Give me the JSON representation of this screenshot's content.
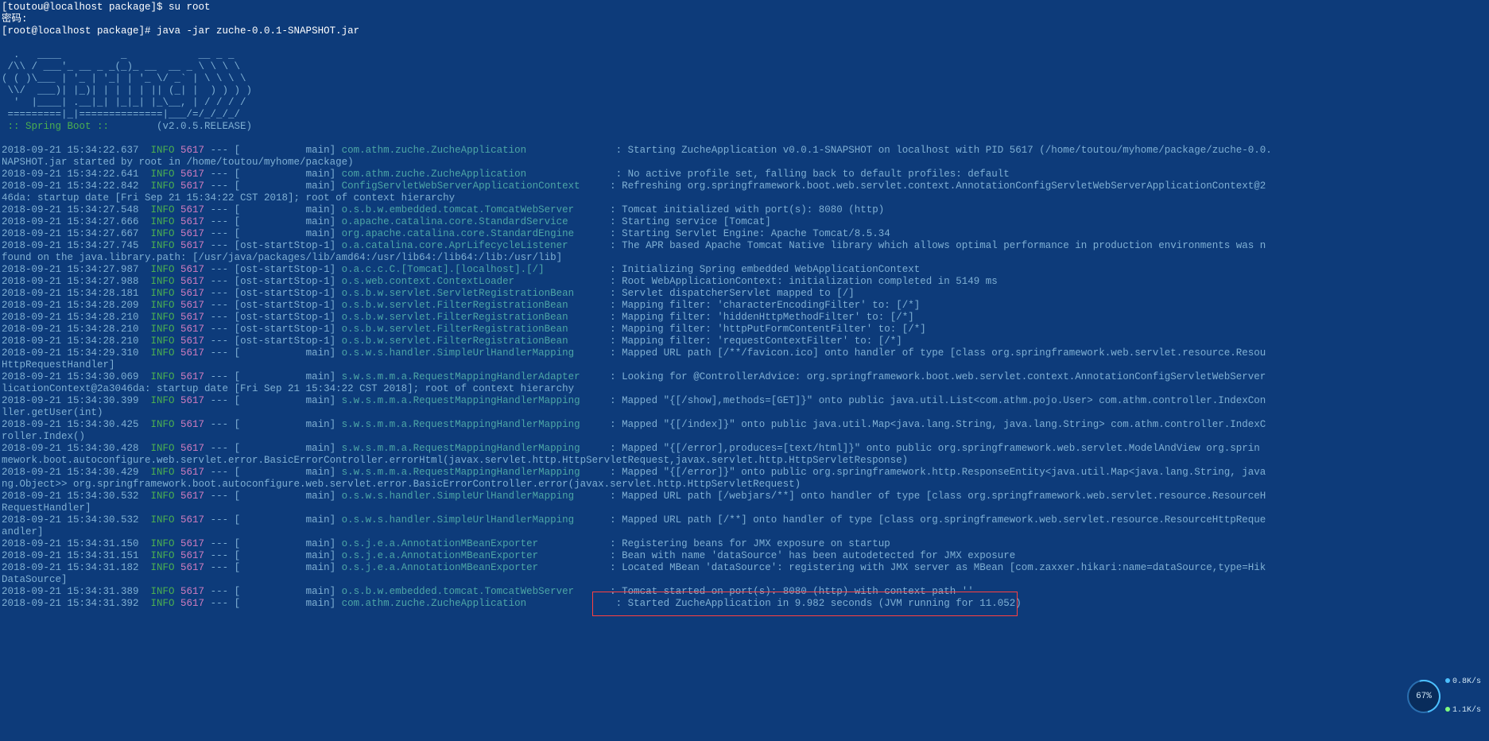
{
  "widget": {
    "percent": "67%",
    "up": "0.8K/s",
    "dn": "1.1K/s"
  },
  "springBanner": {
    "boot_label": " :: Spring Boot ::",
    "version": "(v2.0.5.RELEASE)"
  },
  "cmd": {
    "l1": "[toutou@localhost package]$ su root",
    "l2": "密码:",
    "l3": "[root@localhost package]# java -jar zuche-0.0.1-SNAPSHOT.jar"
  },
  "colsep": " --- [",
  "rows": [
    {
      "ts": "2018-09-21 15:34:22.637",
      "lvl": "INFO ",
      "pid": "5617",
      "thr": "           main] ",
      "cls": "com.athm.zuche.ZucheApplication               ",
      "msg": ": Starting ZucheApplication v0.0.1-SNAPSHOT on localhost with PID 5617 (/home/toutou/myhome/package/zuche-0.0."
    },
    {
      "ts": "",
      "wrap": "NAPSHOT.jar started by root in /home/toutou/myhome/package)"
    },
    {
      "ts": "2018-09-21 15:34:22.641",
      "lvl": "INFO ",
      "pid": "5617",
      "thr": "           main] ",
      "cls": "com.athm.zuche.ZucheApplication               ",
      "msg": ": No active profile set, falling back to default profiles: default"
    },
    {
      "ts": "2018-09-21 15:34:22.842",
      "lvl": "INFO ",
      "pid": "5617",
      "thr": "           main] ",
      "cls": "ConfigServletWebServerApplicationContext     ",
      "msg": ": Refreshing org.springframework.boot.web.servlet.context.AnnotationConfigServletWebServerApplicationContext@2"
    },
    {
      "ts": "",
      "wrap": "46da: startup date [Fri Sep 21 15:34:22 CST 2018]; root of context hierarchy"
    },
    {
      "ts": "2018-09-21 15:34:27.548",
      "lvl": "INFO ",
      "pid": "5617",
      "thr": "           main] ",
      "cls": "o.s.b.w.embedded.tomcat.TomcatWebServer      ",
      "msg": ": Tomcat initialized with port(s): 8080 (http)"
    },
    {
      "ts": "2018-09-21 15:34:27.666",
      "lvl": "INFO ",
      "pid": "5617",
      "thr": "           main] ",
      "cls": "o.apache.catalina.core.StandardService       ",
      "msg": ": Starting service [Tomcat]"
    },
    {
      "ts": "2018-09-21 15:34:27.667",
      "lvl": "INFO ",
      "pid": "5617",
      "thr": "           main] ",
      "cls": "org.apache.catalina.core.StandardEngine      ",
      "msg": ": Starting Servlet Engine: Apache Tomcat/8.5.34"
    },
    {
      "ts": "2018-09-21 15:34:27.745",
      "lvl": "INFO ",
      "pid": "5617",
      "thr": "ost-startStop-1] ",
      "cls": "o.a.catalina.core.AprLifecycleListener       ",
      "msg": ": The APR based Apache Tomcat Native library which allows optimal performance in production environments was n"
    },
    {
      "ts": "",
      "wrap": "found on the java.library.path: [/usr/java/packages/lib/amd64:/usr/lib64:/lib64:/lib:/usr/lib]"
    },
    {
      "ts": "2018-09-21 15:34:27.987",
      "lvl": "INFO ",
      "pid": "5617",
      "thr": "ost-startStop-1] ",
      "cls": "o.a.c.c.C.[Tomcat].[localhost].[/]           ",
      "msg": ": Initializing Spring embedded WebApplicationContext"
    },
    {
      "ts": "2018-09-21 15:34:27.988",
      "lvl": "INFO ",
      "pid": "5617",
      "thr": "ost-startStop-1] ",
      "cls": "o.s.web.context.ContextLoader                ",
      "msg": ": Root WebApplicationContext: initialization completed in 5149 ms"
    },
    {
      "ts": "2018-09-21 15:34:28.181",
      "lvl": "INFO ",
      "pid": "5617",
      "thr": "ost-startStop-1] ",
      "cls": "o.s.b.w.servlet.ServletRegistrationBean      ",
      "msg": ": Servlet dispatcherServlet mapped to [/]"
    },
    {
      "ts": "2018-09-21 15:34:28.209",
      "lvl": "INFO ",
      "pid": "5617",
      "thr": "ost-startStop-1] ",
      "cls": "o.s.b.w.servlet.FilterRegistrationBean       ",
      "msg": ": Mapping filter: 'characterEncodingFilter' to: [/*]"
    },
    {
      "ts": "2018-09-21 15:34:28.210",
      "lvl": "INFO ",
      "pid": "5617",
      "thr": "ost-startStop-1] ",
      "cls": "o.s.b.w.servlet.FilterRegistrationBean       ",
      "msg": ": Mapping filter: 'hiddenHttpMethodFilter' to: [/*]"
    },
    {
      "ts": "2018-09-21 15:34:28.210",
      "lvl": "INFO ",
      "pid": "5617",
      "thr": "ost-startStop-1] ",
      "cls": "o.s.b.w.servlet.FilterRegistrationBean       ",
      "msg": ": Mapping filter: 'httpPutFormContentFilter' to: [/*]"
    },
    {
      "ts": "2018-09-21 15:34:28.210",
      "lvl": "INFO ",
      "pid": "5617",
      "thr": "ost-startStop-1] ",
      "cls": "o.s.b.w.servlet.FilterRegistrationBean       ",
      "msg": ": Mapping filter: 'requestContextFilter' to: [/*]"
    },
    {
      "ts": "2018-09-21 15:34:29.310",
      "lvl": "INFO ",
      "pid": "5617",
      "thr": "           main] ",
      "cls": "o.s.w.s.handler.SimpleUrlHandlerMapping      ",
      "msg": ": Mapped URL path [/**/favicon.ico] onto handler of type [class org.springframework.web.servlet.resource.Resou"
    },
    {
      "ts": "",
      "wrap": "HttpRequestHandler]"
    },
    {
      "ts": "2018-09-21 15:34:30.069",
      "lvl": "INFO ",
      "pid": "5617",
      "thr": "           main] ",
      "cls": "s.w.s.m.m.a.RequestMappingHandlerAdapter     ",
      "msg": ": Looking for @ControllerAdvice: org.springframework.boot.web.servlet.context.AnnotationConfigServletWebServer"
    },
    {
      "ts": "",
      "wrap": "licationContext@2a3046da: startup date [Fri Sep 21 15:34:22 CST 2018]; root of context hierarchy"
    },
    {
      "ts": "2018-09-21 15:34:30.399",
      "lvl": "INFO ",
      "pid": "5617",
      "thr": "           main] ",
      "cls": "s.w.s.m.m.a.RequestMappingHandlerMapping     ",
      "msg": ": Mapped \"{[/show],methods=[GET]}\" onto public java.util.List<com.athm.pojo.User> com.athm.controller.IndexCon"
    },
    {
      "ts": "",
      "wrap": "ller.getUser(int)"
    },
    {
      "ts": "2018-09-21 15:34:30.425",
      "lvl": "INFO ",
      "pid": "5617",
      "thr": "           main] ",
      "cls": "s.w.s.m.m.a.RequestMappingHandlerMapping     ",
      "msg": ": Mapped \"{[/index]}\" onto public java.util.Map<java.lang.String, java.lang.String> com.athm.controller.IndexC"
    },
    {
      "ts": "",
      "wrap": "roller.Index()"
    },
    {
      "ts": "2018-09-21 15:34:30.428",
      "lvl": "INFO ",
      "pid": "5617",
      "thr": "           main] ",
      "cls": "s.w.s.m.m.a.RequestMappingHandlerMapping     ",
      "msg": ": Mapped \"{[/error],produces=[text/html]}\" onto public org.springframework.web.servlet.ModelAndView org.sprin"
    },
    {
      "ts": "",
      "wrap": "mework.boot.autoconfigure.web.servlet.error.BasicErrorController.errorHtml(javax.servlet.http.HttpServletRequest,javax.servlet.http.HttpServletResponse)"
    },
    {
      "ts": "2018-09-21 15:34:30.429",
      "lvl": "INFO ",
      "pid": "5617",
      "thr": "           main] ",
      "cls": "s.w.s.m.m.a.RequestMappingHandlerMapping     ",
      "msg": ": Mapped \"{[/error]}\" onto public org.springframework.http.ResponseEntity<java.util.Map<java.lang.String, java"
    },
    {
      "ts": "",
      "wrap": "ng.Object>> org.springframework.boot.autoconfigure.web.servlet.error.BasicErrorController.error(javax.servlet.http.HttpServletRequest)"
    },
    {
      "ts": "2018-09-21 15:34:30.532",
      "lvl": "INFO ",
      "pid": "5617",
      "thr": "           main] ",
      "cls": "o.s.w.s.handler.SimpleUrlHandlerMapping      ",
      "msg": ": Mapped URL path [/webjars/**] onto handler of type [class org.springframework.web.servlet.resource.ResourceH"
    },
    {
      "ts": "",
      "wrap": "RequestHandler]"
    },
    {
      "ts": "2018-09-21 15:34:30.532",
      "lvl": "INFO ",
      "pid": "5617",
      "thr": "           main] ",
      "cls": "o.s.w.s.handler.SimpleUrlHandlerMapping      ",
      "msg": ": Mapped URL path [/**] onto handler of type [class org.springframework.web.servlet.resource.ResourceHttpReque"
    },
    {
      "ts": "",
      "wrap": "andler]"
    },
    {
      "ts": "2018-09-21 15:34:31.150",
      "lvl": "INFO ",
      "pid": "5617",
      "thr": "           main] ",
      "cls": "o.s.j.e.a.AnnotationMBeanExporter            ",
      "msg": ": Registering beans for JMX exposure on startup"
    },
    {
      "ts": "2018-09-21 15:34:31.151",
      "lvl": "INFO ",
      "pid": "5617",
      "thr": "           main] ",
      "cls": "o.s.j.e.a.AnnotationMBeanExporter            ",
      "msg": ": Bean with name 'dataSource' has been autodetected for JMX exposure"
    },
    {
      "ts": "2018-09-21 15:34:31.182",
      "lvl": "INFO ",
      "pid": "5617",
      "thr": "           main] ",
      "cls": "o.s.j.e.a.AnnotationMBeanExporter            ",
      "msg": ": Located MBean 'dataSource': registering with JMX server as MBean [com.zaxxer.hikari:name=dataSource,type=Hik"
    },
    {
      "ts": "",
      "wrap": "DataSource]"
    },
    {
      "ts": "2018-09-21 15:34:31.389",
      "lvl": "INFO ",
      "pid": "5617",
      "thr": "           main] ",
      "cls": "o.s.b.w.embedded.tomcat.TomcatWebServer      ",
      "msg": ": Tomcat started on port(s): 8080 (http) with context path ''"
    },
    {
      "ts": "2018-09-21 15:34:31.392",
      "lvl": "INFO ",
      "pid": "5617",
      "thr": "           main] ",
      "cls": "com.athm.zuche.ZucheApplication               ",
      "msg": ": Started ZucheApplication in 9.982 seconds (JVM running for 11.052)"
    }
  ],
  "asciiArt": "\n  .   ____          _            __ _ _\n /\\\\ / ___'_ __ _ _(_)_ __  __ _ \\ \\ \\ \\\n( ( )\\___ | '_ | '_| | '_ \\/ _` | \\ \\ \\ \\\n \\\\/  ___)| |_)| | | | | || (_| |  ) ) ) )\n  '  |____| .__|_| |_|_| |_\\__, | / / / /\n =========|_|==============|___/=/_/_/_/"
}
